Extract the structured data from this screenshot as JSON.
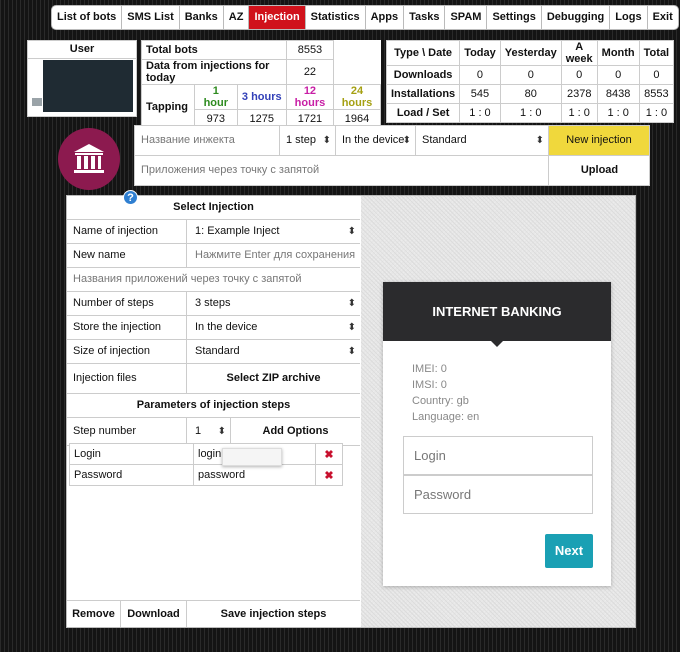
{
  "nav": [
    "List of bots",
    "SMS List",
    "Banks",
    "AZ",
    "Injection",
    "Statistics",
    "Apps",
    "Tasks",
    "SPAM",
    "Settings",
    "Debugging",
    "Logs",
    "Exit"
  ],
  "user": {
    "header": "User"
  },
  "totals": {
    "total_bots_label": "Total bots",
    "total_bots": "8553",
    "today_label": "Data from injections for today",
    "today": "22",
    "tapping_label": "Tapping",
    "tapping": [
      {
        "label": "1 hour",
        "value": "973"
      },
      {
        "label": "3 hours",
        "value": "1275"
      },
      {
        "label": "12 hours",
        "value": "1721"
      },
      {
        "label": "24 hours",
        "value": "1964"
      }
    ]
  },
  "stats": {
    "headers": [
      "Type \\ Date",
      "Today",
      "Yesterday",
      "A week",
      "Month",
      "Total"
    ],
    "rows": [
      [
        "Downloads",
        "0",
        "0",
        "0",
        "0",
        "0"
      ],
      [
        "Installations",
        "545",
        "80",
        "2378",
        "8438",
        "8553"
      ],
      [
        "Load / Set",
        "1 : 0",
        "1 : 0",
        "1 : 0",
        "1 : 0",
        "1 : 0"
      ]
    ]
  },
  "inject_bar": {
    "name_placeholder": "Название инжекта",
    "steps": "1 step",
    "location": "In the device",
    "size": "Standard",
    "new_label": "New injection",
    "apps_placeholder": "Приложения через точку с запятой",
    "upload_label": "Upload"
  },
  "form": {
    "title": "Select Injection",
    "name_label": "Name of injection",
    "name_value": "1: Example Inject",
    "newname_label": "New name",
    "newname_placeholder": "Нажмите Enter для сохранения",
    "apps_placeholder": "Названия приложений через точку с запятой",
    "steps_label": "Number of steps",
    "steps_value": "3 steps",
    "store_label": "Store the injection",
    "store_value": "In the device",
    "size_label": "Size of injection",
    "size_value": "Standard",
    "files_label": "Injection files",
    "zip_label": "Select ZIP archive",
    "params_title": "Parameters of injection steps",
    "stepnum_label": "Step number",
    "stepnum_value": "1",
    "add_options": "Add Options",
    "fields": [
      {
        "name": "Login",
        "value": "login"
      },
      {
        "name": "Password",
        "value": "password"
      }
    ],
    "remove": "Remove",
    "download": "Download",
    "save": "Save injection steps"
  },
  "help": "?",
  "card": {
    "header": "INTERNET BANKING",
    "imei": "IMEI: 0",
    "imsi": "IMSI: 0",
    "country": "Country: gb",
    "language": "Language: en",
    "login_placeholder": "Login",
    "password_placeholder": "Password",
    "next": "Next"
  },
  "colors": {
    "accent_red": "#d0121b",
    "new_injection": "#f0d83c",
    "bank_icon_bg": "#8c1a4f",
    "next_button": "#1aa0b4"
  },
  "icons": [
    "bank-icon",
    "help-icon",
    "delete-icon"
  ]
}
